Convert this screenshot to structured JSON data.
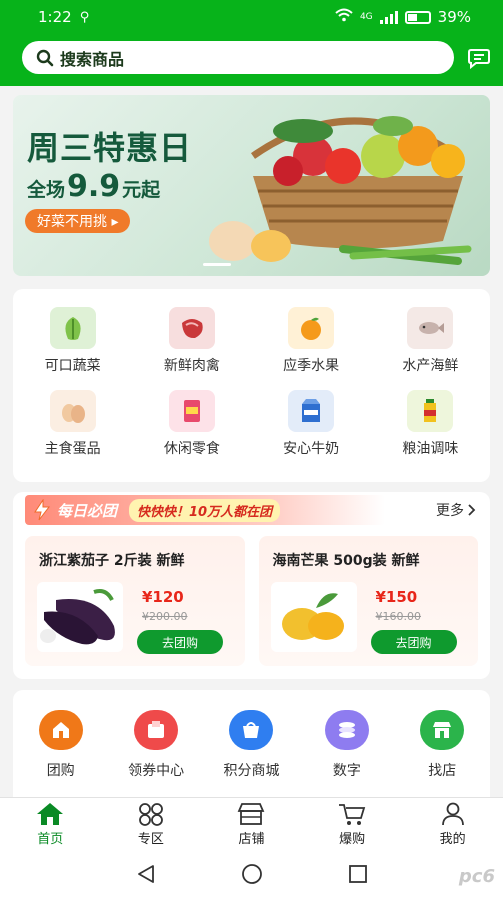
{
  "status_bar": {
    "time": "1:22",
    "battery": "39%",
    "network": "4G"
  },
  "search": {
    "placeholder": "搜索商品"
  },
  "banner": {
    "title": "周三特惠日",
    "subtitle_prefix": "全场",
    "subtitle_price": "9.9",
    "subtitle_suffix": "元起",
    "tag": "好菜不用挑 ▸"
  },
  "categories": [
    {
      "label": "可口蔬菜",
      "icon": "vegetable-icon",
      "color": "#dff1d6"
    },
    {
      "label": "新鲜肉禽",
      "icon": "meat-icon",
      "color": "#f7dede"
    },
    {
      "label": "应季水果",
      "icon": "fruit-icon",
      "color": "#fff1d6"
    },
    {
      "label": "水产海鲜",
      "icon": "seafood-icon",
      "color": "#f4e9e6"
    },
    {
      "label": "主食蛋品",
      "icon": "egg-icon",
      "color": "#fbeee2"
    },
    {
      "label": "休闲零食",
      "icon": "snack-icon",
      "color": "#fde2e8"
    },
    {
      "label": "安心牛奶",
      "icon": "milk-icon",
      "color": "#e3ecf9"
    },
    {
      "label": "粮油调味",
      "icon": "oil-icon",
      "color": "#eef6dc"
    }
  ],
  "group_buy": {
    "title": "每日必团",
    "slogan": "快快快！10万人都在团",
    "more": "更多",
    "items": [
      {
        "name": "浙江紫茄子 2斤装 新鲜",
        "price": "¥120",
        "original_price": "¥200.00",
        "button": "去团购",
        "icon": "eggplant-icon"
      },
      {
        "name": "海南芒果 500g装 新鲜",
        "price": "¥150",
        "original_price": "¥160.00",
        "button": "去团购",
        "icon": "mango-icon"
      }
    ]
  },
  "services": [
    {
      "label": "团购",
      "icon": "group-buy-icon",
      "color": "#f07818"
    },
    {
      "label": "领券中心",
      "icon": "coupon-icon",
      "color": "#ef4a4a"
    },
    {
      "label": "积分商城",
      "icon": "points-mall-icon",
      "color": "#2f7ef0"
    },
    {
      "label": "数字",
      "icon": "digital-icon",
      "color": "#8e7cf0"
    },
    {
      "label": "找店",
      "icon": "store-finder-icon",
      "color": "#2bb44b"
    }
  ],
  "tabs": [
    {
      "label": "首页",
      "icon": "home-icon",
      "active": true
    },
    {
      "label": "专区",
      "icon": "zone-icon",
      "active": false
    },
    {
      "label": "店铺",
      "icon": "shop-icon",
      "active": false
    },
    {
      "label": "爆购",
      "icon": "cart-icon",
      "active": false
    },
    {
      "label": "我的",
      "icon": "profile-icon",
      "active": false
    }
  ],
  "watermark": "pc6"
}
